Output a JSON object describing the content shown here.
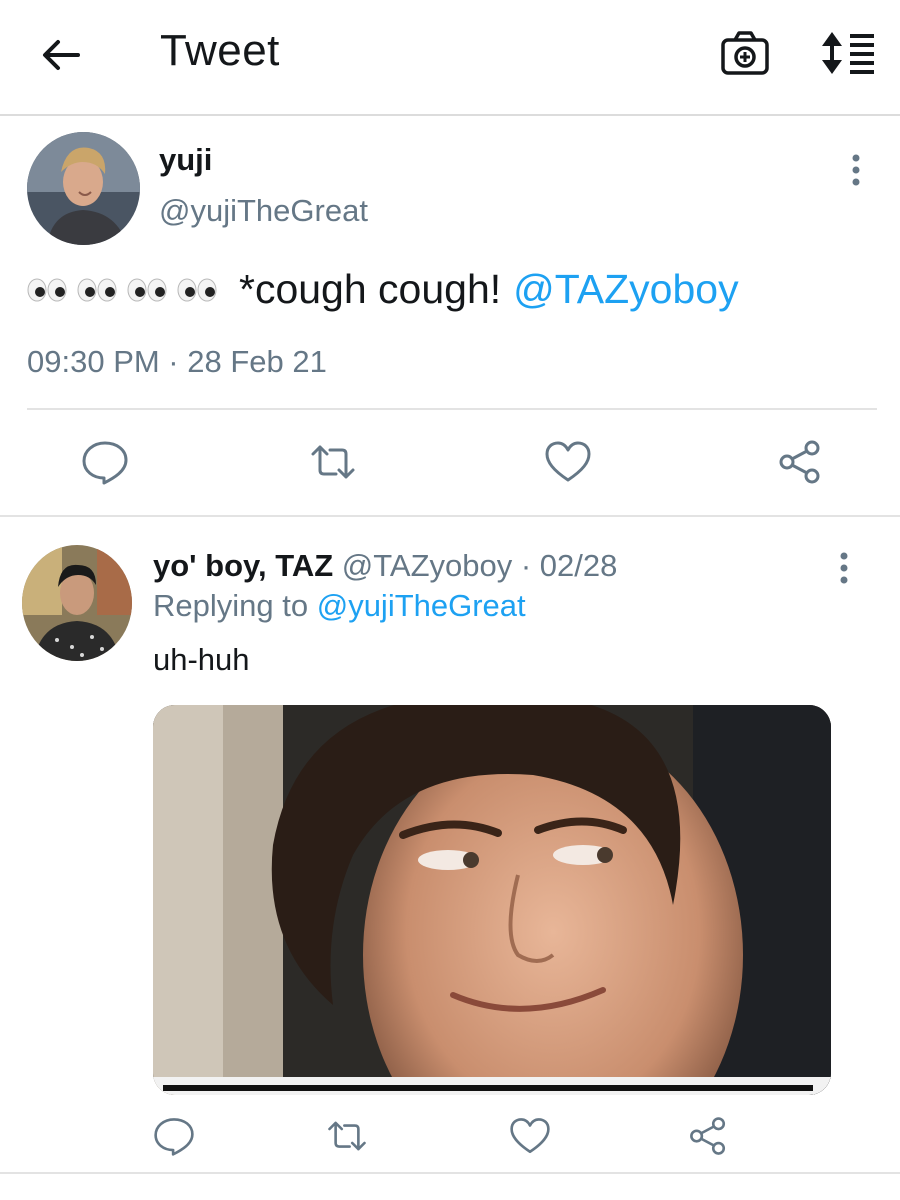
{
  "header": {
    "title": "Tweet"
  },
  "tweet": {
    "name": "yuji",
    "handle": "@yujiTheGreat",
    "text": "*cough cough!",
    "mention": "@TAZyoboy",
    "timestamp": "09:30 PM · 28 Feb 21"
  },
  "reply": {
    "name": "yo' boy, TAZ",
    "handle_date": "@TAZyoboy · 02/28",
    "replying_prefix": "Replying to",
    "replying_handle": "@yujiTheGreat",
    "text": "uh-huh"
  },
  "colors": {
    "link": "#1da1f2",
    "secondary_text": "#657786",
    "primary_text": "#14171a",
    "icon": "#657786"
  }
}
